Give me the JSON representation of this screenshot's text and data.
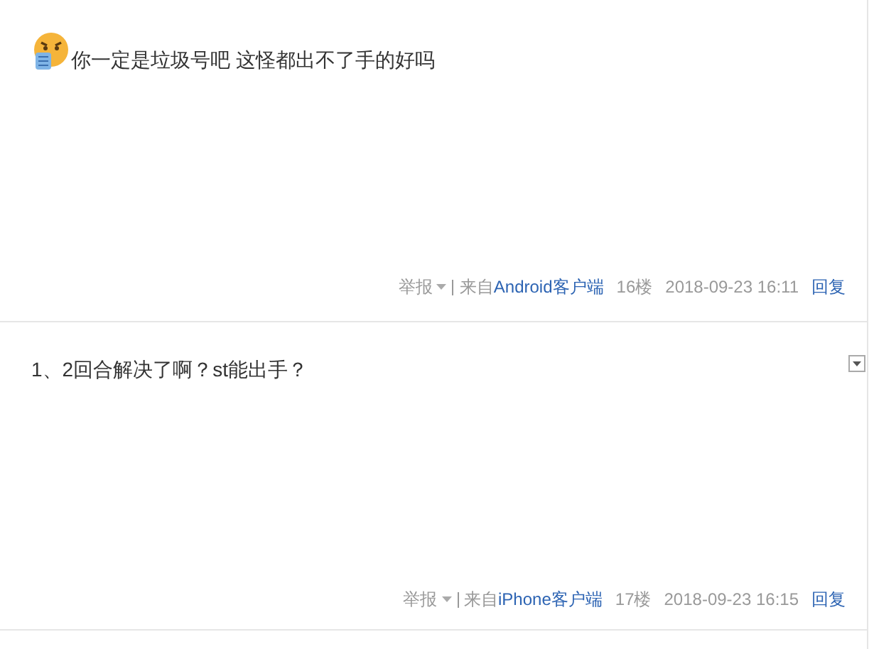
{
  "posts": [
    {
      "emoji": true,
      "menu": false,
      "text": "你一定是垃圾号吧 这怪都出不了手的好吗",
      "report": "举报",
      "source_prefix": "来自",
      "source": "Android客户端",
      "floor": "16楼",
      "time": "2018-09-23 16:11",
      "reply": "回复"
    },
    {
      "emoji": false,
      "menu": true,
      "text": "1、2回合解决了啊？st能出手？",
      "report": "举报",
      "source_prefix": "来自",
      "source": "iPhone客户端",
      "floor": "17楼",
      "time": "2018-09-23 16:15",
      "reply": "回复"
    }
  ]
}
